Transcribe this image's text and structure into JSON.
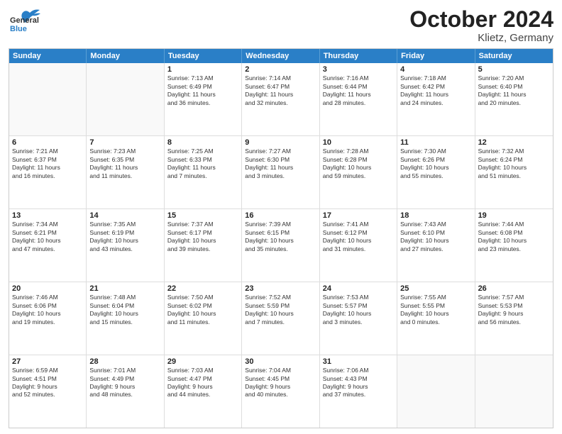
{
  "header": {
    "logo_general": "General",
    "logo_blue": "Blue",
    "month": "October 2024",
    "location": "Klietz, Germany"
  },
  "weekdays": [
    "Sunday",
    "Monday",
    "Tuesday",
    "Wednesday",
    "Thursday",
    "Friday",
    "Saturday"
  ],
  "rows": [
    [
      {
        "day": "",
        "lines": []
      },
      {
        "day": "",
        "lines": []
      },
      {
        "day": "1",
        "lines": [
          "Sunrise: 7:13 AM",
          "Sunset: 6:49 PM",
          "Daylight: 11 hours",
          "and 36 minutes."
        ]
      },
      {
        "day": "2",
        "lines": [
          "Sunrise: 7:14 AM",
          "Sunset: 6:47 PM",
          "Daylight: 11 hours",
          "and 32 minutes."
        ]
      },
      {
        "day": "3",
        "lines": [
          "Sunrise: 7:16 AM",
          "Sunset: 6:44 PM",
          "Daylight: 11 hours",
          "and 28 minutes."
        ]
      },
      {
        "day": "4",
        "lines": [
          "Sunrise: 7:18 AM",
          "Sunset: 6:42 PM",
          "Daylight: 11 hours",
          "and 24 minutes."
        ]
      },
      {
        "day": "5",
        "lines": [
          "Sunrise: 7:20 AM",
          "Sunset: 6:40 PM",
          "Daylight: 11 hours",
          "and 20 minutes."
        ]
      }
    ],
    [
      {
        "day": "6",
        "lines": [
          "Sunrise: 7:21 AM",
          "Sunset: 6:37 PM",
          "Daylight: 11 hours",
          "and 16 minutes."
        ]
      },
      {
        "day": "7",
        "lines": [
          "Sunrise: 7:23 AM",
          "Sunset: 6:35 PM",
          "Daylight: 11 hours",
          "and 11 minutes."
        ]
      },
      {
        "day": "8",
        "lines": [
          "Sunrise: 7:25 AM",
          "Sunset: 6:33 PM",
          "Daylight: 11 hours",
          "and 7 minutes."
        ]
      },
      {
        "day": "9",
        "lines": [
          "Sunrise: 7:27 AM",
          "Sunset: 6:30 PM",
          "Daylight: 11 hours",
          "and 3 minutes."
        ]
      },
      {
        "day": "10",
        "lines": [
          "Sunrise: 7:28 AM",
          "Sunset: 6:28 PM",
          "Daylight: 10 hours",
          "and 59 minutes."
        ]
      },
      {
        "day": "11",
        "lines": [
          "Sunrise: 7:30 AM",
          "Sunset: 6:26 PM",
          "Daylight: 10 hours",
          "and 55 minutes."
        ]
      },
      {
        "day": "12",
        "lines": [
          "Sunrise: 7:32 AM",
          "Sunset: 6:24 PM",
          "Daylight: 10 hours",
          "and 51 minutes."
        ]
      }
    ],
    [
      {
        "day": "13",
        "lines": [
          "Sunrise: 7:34 AM",
          "Sunset: 6:21 PM",
          "Daylight: 10 hours",
          "and 47 minutes."
        ]
      },
      {
        "day": "14",
        "lines": [
          "Sunrise: 7:35 AM",
          "Sunset: 6:19 PM",
          "Daylight: 10 hours",
          "and 43 minutes."
        ]
      },
      {
        "day": "15",
        "lines": [
          "Sunrise: 7:37 AM",
          "Sunset: 6:17 PM",
          "Daylight: 10 hours",
          "and 39 minutes."
        ]
      },
      {
        "day": "16",
        "lines": [
          "Sunrise: 7:39 AM",
          "Sunset: 6:15 PM",
          "Daylight: 10 hours",
          "and 35 minutes."
        ]
      },
      {
        "day": "17",
        "lines": [
          "Sunrise: 7:41 AM",
          "Sunset: 6:12 PM",
          "Daylight: 10 hours",
          "and 31 minutes."
        ]
      },
      {
        "day": "18",
        "lines": [
          "Sunrise: 7:43 AM",
          "Sunset: 6:10 PM",
          "Daylight: 10 hours",
          "and 27 minutes."
        ]
      },
      {
        "day": "19",
        "lines": [
          "Sunrise: 7:44 AM",
          "Sunset: 6:08 PM",
          "Daylight: 10 hours",
          "and 23 minutes."
        ]
      }
    ],
    [
      {
        "day": "20",
        "lines": [
          "Sunrise: 7:46 AM",
          "Sunset: 6:06 PM",
          "Daylight: 10 hours",
          "and 19 minutes."
        ]
      },
      {
        "day": "21",
        "lines": [
          "Sunrise: 7:48 AM",
          "Sunset: 6:04 PM",
          "Daylight: 10 hours",
          "and 15 minutes."
        ]
      },
      {
        "day": "22",
        "lines": [
          "Sunrise: 7:50 AM",
          "Sunset: 6:02 PM",
          "Daylight: 10 hours",
          "and 11 minutes."
        ]
      },
      {
        "day": "23",
        "lines": [
          "Sunrise: 7:52 AM",
          "Sunset: 5:59 PM",
          "Daylight: 10 hours",
          "and 7 minutes."
        ]
      },
      {
        "day": "24",
        "lines": [
          "Sunrise: 7:53 AM",
          "Sunset: 5:57 PM",
          "Daylight: 10 hours",
          "and 3 minutes."
        ]
      },
      {
        "day": "25",
        "lines": [
          "Sunrise: 7:55 AM",
          "Sunset: 5:55 PM",
          "Daylight: 10 hours",
          "and 0 minutes."
        ]
      },
      {
        "day": "26",
        "lines": [
          "Sunrise: 7:57 AM",
          "Sunset: 5:53 PM",
          "Daylight: 9 hours",
          "and 56 minutes."
        ]
      }
    ],
    [
      {
        "day": "27",
        "lines": [
          "Sunrise: 6:59 AM",
          "Sunset: 4:51 PM",
          "Daylight: 9 hours",
          "and 52 minutes."
        ]
      },
      {
        "day": "28",
        "lines": [
          "Sunrise: 7:01 AM",
          "Sunset: 4:49 PM",
          "Daylight: 9 hours",
          "and 48 minutes."
        ]
      },
      {
        "day": "29",
        "lines": [
          "Sunrise: 7:03 AM",
          "Sunset: 4:47 PM",
          "Daylight: 9 hours",
          "and 44 minutes."
        ]
      },
      {
        "day": "30",
        "lines": [
          "Sunrise: 7:04 AM",
          "Sunset: 4:45 PM",
          "Daylight: 9 hours",
          "and 40 minutes."
        ]
      },
      {
        "day": "31",
        "lines": [
          "Sunrise: 7:06 AM",
          "Sunset: 4:43 PM",
          "Daylight: 9 hours",
          "and 37 minutes."
        ]
      },
      {
        "day": "",
        "lines": []
      },
      {
        "day": "",
        "lines": []
      }
    ]
  ]
}
